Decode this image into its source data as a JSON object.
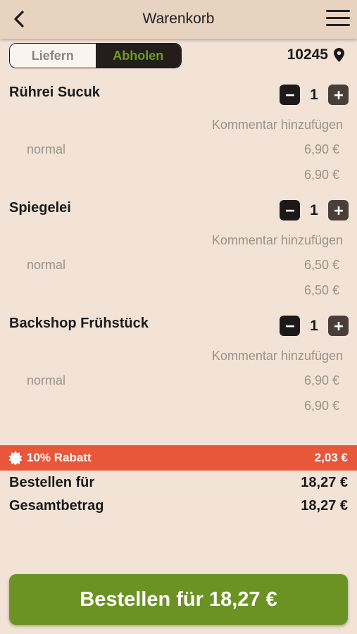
{
  "header": {
    "title": "Warenkorb",
    "back_icon": "chevron-left-icon",
    "menu_icon": "hamburger-icon"
  },
  "delivery_toggle": {
    "options": [
      {
        "label": "Liefern",
        "active": false
      },
      {
        "label": "Abholen",
        "active": true
      }
    ]
  },
  "location": {
    "zip": "10245",
    "icon": "map-pin-icon"
  },
  "items": [
    {
      "name": "Rührei Sucuk",
      "quantity": "1",
      "comment_label": "Kommentar hinzufügen",
      "variant": "normal",
      "variant_price": "6,90 €",
      "total": "6,90 €"
    },
    {
      "name": "Spiegelei",
      "quantity": "1",
      "comment_label": "Kommentar hinzufügen",
      "variant": "normal",
      "variant_price": "6,50 €",
      "total": "6,50 €"
    },
    {
      "name": "Backshop Frühstück",
      "quantity": "1",
      "comment_label": "Kommentar hinzufügen",
      "variant": "normal",
      "variant_price": "6,90 €",
      "total": "6,90 €"
    }
  ],
  "discount": {
    "label": "10% Rabatt",
    "amount": "2,03 €",
    "icon": "discount-badge-icon"
  },
  "summary": {
    "order_for_label": "Bestellen für",
    "order_for_value": "18,27 €",
    "total_label": "Gesamtbetrag",
    "total_value": "18,27 €"
  },
  "order_button": {
    "label": "Bestellen für 18,27 €"
  },
  "colors": {
    "background": "#f2e3d6",
    "header": "#e7d3bf",
    "accent_green": "#6b9323",
    "discount_red": "#e8573a",
    "dark": "#231e1c"
  }
}
